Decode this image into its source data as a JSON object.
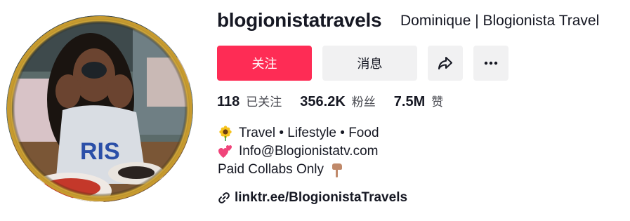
{
  "profile": {
    "username": "blogionistatravels",
    "display_name": "Dominique | Blogionista Travel",
    "avatar_icon": "profile-photo"
  },
  "actions": {
    "follow_label": "关注",
    "message_label": "消息",
    "share_icon": "share-icon",
    "more_icon": "more-icon"
  },
  "stats": [
    {
      "value": "118",
      "label": "已关注"
    },
    {
      "value": "356.2K",
      "label": "粉丝"
    },
    {
      "value": "7.5M",
      "label": "赞"
    }
  ],
  "bio": {
    "lines": [
      {
        "emoji": "sunflower-icon",
        "text": "Travel • Lifestyle • Food"
      },
      {
        "emoji": "two-hearts-icon",
        "text": "Info@Blogionistatv.com"
      },
      {
        "emoji": "pointing-down-hand-icon",
        "text": "Paid Collabs Only"
      }
    ]
  },
  "link": {
    "icon": "link-icon",
    "text": "linktr.ee/BlogionistaTravels"
  },
  "colors": {
    "accent": "#fe2c55",
    "button_bg": "#f1f1f2",
    "text": "#161823",
    "secondary_text": "#4a4b52"
  }
}
